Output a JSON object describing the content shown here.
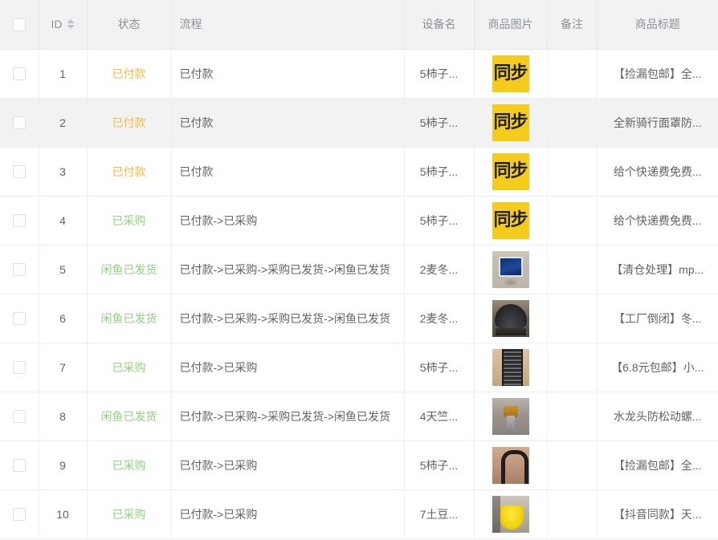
{
  "colors": {
    "header_bg": "#f2f2f2",
    "header_text": "#8d9199",
    "body_text": "#606266",
    "border": "#ebeef5",
    "row_hover_bg": "#f2f2f2",
    "status_paid": "#f5b942",
    "status_purchased": "#8fd17e",
    "status_shipped": "#8fd17e",
    "sync_thumb_bg": "#f5cc1b"
  },
  "table": {
    "columns": [
      {
        "key": "check",
        "label": "",
        "icon": "checkbox-icon"
      },
      {
        "key": "id",
        "label": "ID",
        "icon": "sort-caret-icon"
      },
      {
        "key": "status",
        "label": "状态",
        "icon": ""
      },
      {
        "key": "flow",
        "label": "流程",
        "icon": ""
      },
      {
        "key": "device",
        "label": "设备名",
        "icon": ""
      },
      {
        "key": "image",
        "label": "商品图片",
        "icon": ""
      },
      {
        "key": "note",
        "label": "备注",
        "icon": ""
      },
      {
        "key": "title",
        "label": "商品标题",
        "icon": ""
      }
    ],
    "rows": [
      {
        "id": "1",
        "status": "已付款",
        "status_kind": "paid",
        "flow": "已付款",
        "device": "5柿子...",
        "image_kind": "sync",
        "image_label": "同步",
        "note": "",
        "title": "【捡漏包邮】全...",
        "hover": false
      },
      {
        "id": "2",
        "status": "已付款",
        "status_kind": "paid",
        "flow": "已付款",
        "device": "5柿子...",
        "image_kind": "sync",
        "image_label": "同步",
        "note": "",
        "title": "全新骑行面罩防...",
        "hover": true
      },
      {
        "id": "3",
        "status": "已付款",
        "status_kind": "paid",
        "flow": "已付款",
        "device": "5柿子...",
        "image_kind": "sync",
        "image_label": "同步",
        "note": "",
        "title": "给个快递费免费...",
        "hover": false
      },
      {
        "id": "4",
        "status": "已采购",
        "status_kind": "purchased",
        "flow": "已付款->已采购",
        "device": "5柿子...",
        "image_kind": "sync",
        "image_label": "同步",
        "note": "",
        "title": "给个快递费免费...",
        "hover": false
      },
      {
        "id": "5",
        "status": "闲鱼已发货",
        "status_kind": "shipped",
        "flow": "已付款->已采购->采购已发货->闲鱼已发货",
        "device": "2麦冬...",
        "image_kind": "mp3",
        "image_label": "",
        "note": "",
        "title": "【清仓处理】mp...",
        "hover": false
      },
      {
        "id": "6",
        "status": "闲鱼已发货",
        "status_kind": "shipped",
        "flow": "已付款->已采购->采购已发货->闲鱼已发货",
        "device": "2麦冬...",
        "image_kind": "helmet",
        "image_label": "",
        "note": "",
        "title": "【工厂倒闭】冬...",
        "hover": false
      },
      {
        "id": "7",
        "status": "已采购",
        "status_kind": "purchased",
        "flow": "已付款->已采购",
        "device": "5柿子...",
        "image_kind": "screwdriver",
        "image_label": "",
        "note": "",
        "title": "【6.8元包邮】小...",
        "hover": false
      },
      {
        "id": "8",
        "status": "闲鱼已发货",
        "status_kind": "shipped",
        "flow": "已付款->已采购->采购已发货->闲鱼已发货",
        "device": "4天竺...",
        "image_kind": "faucet",
        "image_label": "",
        "note": "",
        "title": "水龙头防松动螺...",
        "hover": false
      },
      {
        "id": "9",
        "status": "已采购",
        "status_kind": "purchased",
        "flow": "已付款->已采购",
        "device": "5柿子...",
        "image_kind": "gripper",
        "image_label": "",
        "note": "",
        "title": "【捡漏包邮】全...",
        "hover": false
      },
      {
        "id": "10",
        "status": "已采购",
        "status_kind": "purchased",
        "flow": "已付款->已采购",
        "device": "7土豆...",
        "image_kind": "basket",
        "image_label": "",
        "note": "",
        "title": "【抖音同款】天...",
        "hover": false
      }
    ]
  }
}
